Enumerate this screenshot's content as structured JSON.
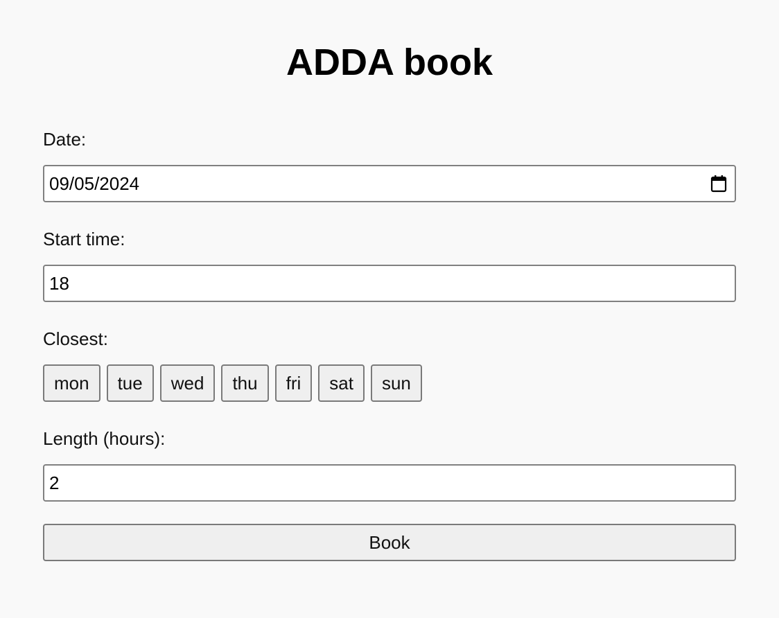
{
  "title": "ADDA book",
  "form": {
    "date": {
      "label": "Date:",
      "value": "09/05/2024",
      "icon": "calendar-icon"
    },
    "start_time": {
      "label": "Start time:",
      "value": "18"
    },
    "closest": {
      "label": "Closest:",
      "days": [
        "mon",
        "tue",
        "wed",
        "thu",
        "fri",
        "sat",
        "sun"
      ]
    },
    "length": {
      "label": "Length (hours):",
      "value": "2"
    },
    "submit_label": "Book"
  }
}
